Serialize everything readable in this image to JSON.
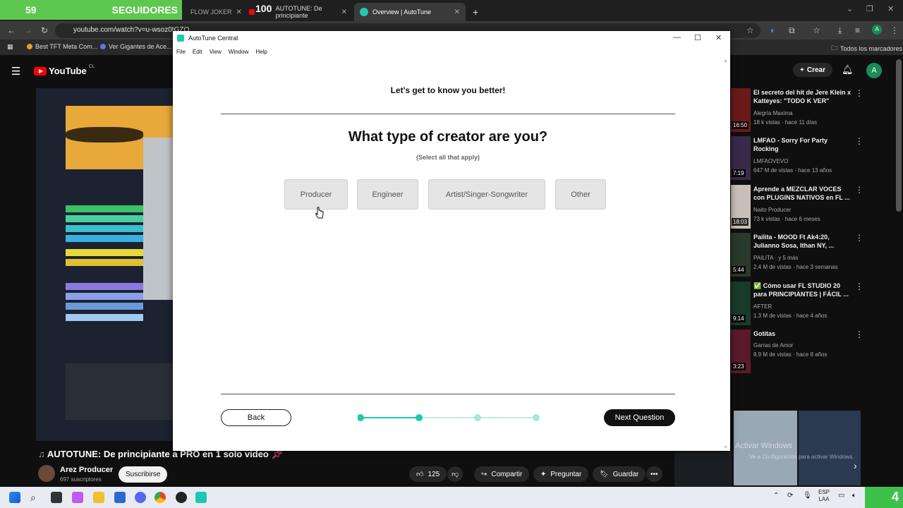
{
  "browser": {
    "overlay_left_number": "59",
    "overlay_left_text": "SEGUIDORES",
    "overlay_mid_number": "100",
    "tabs": [
      {
        "label": "FLOW JOKER"
      },
      {
        "label": "AUTOTUNE: De principiante"
      },
      {
        "label": "Overview | AutoTune"
      }
    ],
    "new_tab": "+",
    "url": "youtube.com/watch?v=u-wsoz0tGZQ",
    "bookmarks": [
      {
        "label": "Best TFT Meta Com..."
      },
      {
        "label": "Ver Gigantes de Ace..."
      }
    ],
    "all_bookmarks": "Todos los marcadores"
  },
  "youtube": {
    "logo": "YouTube",
    "logo_region": "CL",
    "create_label": "Crear",
    "avatar_letter": "A",
    "video_title": "AUTOTUNE: De principiante a PRO en 1 solo video",
    "channel_name": "Arez Producer",
    "subscribers": "697 suscriptores",
    "subscribe_label": "Suscribirse",
    "likes": "125",
    "share_label": "Compartir",
    "ask_label": "Preguntar",
    "save_label": "Guardar",
    "watermark": "Activar Windows",
    "watermark_sub": "Ve a Configuración para activar Windows.",
    "recommendations": [
      {
        "title": "El secreto del hit de Jere Klein x Katteyes: \"TODO K VER\"",
        "channel": "Alegría Maxima",
        "meta": "18 k vistas · hace 11 días",
        "duration": "16:50",
        "color": "#6b1a1a"
      },
      {
        "title": "LMFAO - Sorry For Party Rocking",
        "channel": "LMFAOVEVO",
        "meta": "647 M de vistas · hace 13 años",
        "duration": "7:19",
        "color": "#3a2a4a"
      },
      {
        "title": "Aprende a MEZCLAR VOCES con PLUGINS NATIVOS en FL ...",
        "channel": "Naito Producer",
        "meta": "73 k vistas · hace 6 meses",
        "duration": "18:03",
        "color": "#c8c0b8"
      },
      {
        "title": "Pailita - MOOD Ft Ak4:20, Julianno Sosa, Ithan NY, ...",
        "channel": "PAILITA · y 5 más",
        "meta": "2.4 M de vistas · hace 3 semanas",
        "duration": "5:44",
        "color": "#2a3a2a"
      },
      {
        "title": "✅ Cómo usar FL STUDIO 20 para PRINCIPIANTES | FÁCIL ...",
        "channel": "AFTER",
        "meta": "1.3 M de vistas · hace 4 años",
        "duration": "9:14",
        "color": "#1a3a2a"
      },
      {
        "title": "Gotitas",
        "channel": "Garras de Amor",
        "meta": "8.9 M de vistas · hace 8 años",
        "duration": "3:23",
        "color": "#5a1a2a"
      }
    ]
  },
  "taskbar": {
    "lang": "ESP",
    "lang_sub": "LAA",
    "overlay_number": "4"
  },
  "autotune": {
    "window_title": "AutoTune Central",
    "menu": [
      "File",
      "Edit",
      "View",
      "Window",
      "Help"
    ],
    "intro": "Let's get to know you better!",
    "question": "What type of creator are you?",
    "hint": "(Select all that apply)",
    "options": [
      "Producer",
      "Engineer",
      "Artist/Singer-Songwriter",
      "Other"
    ],
    "back_label": "Back",
    "next_label": "Next Question",
    "progress": {
      "steps": 4,
      "current": 2
    },
    "accent_color": "#1fc9b0"
  }
}
